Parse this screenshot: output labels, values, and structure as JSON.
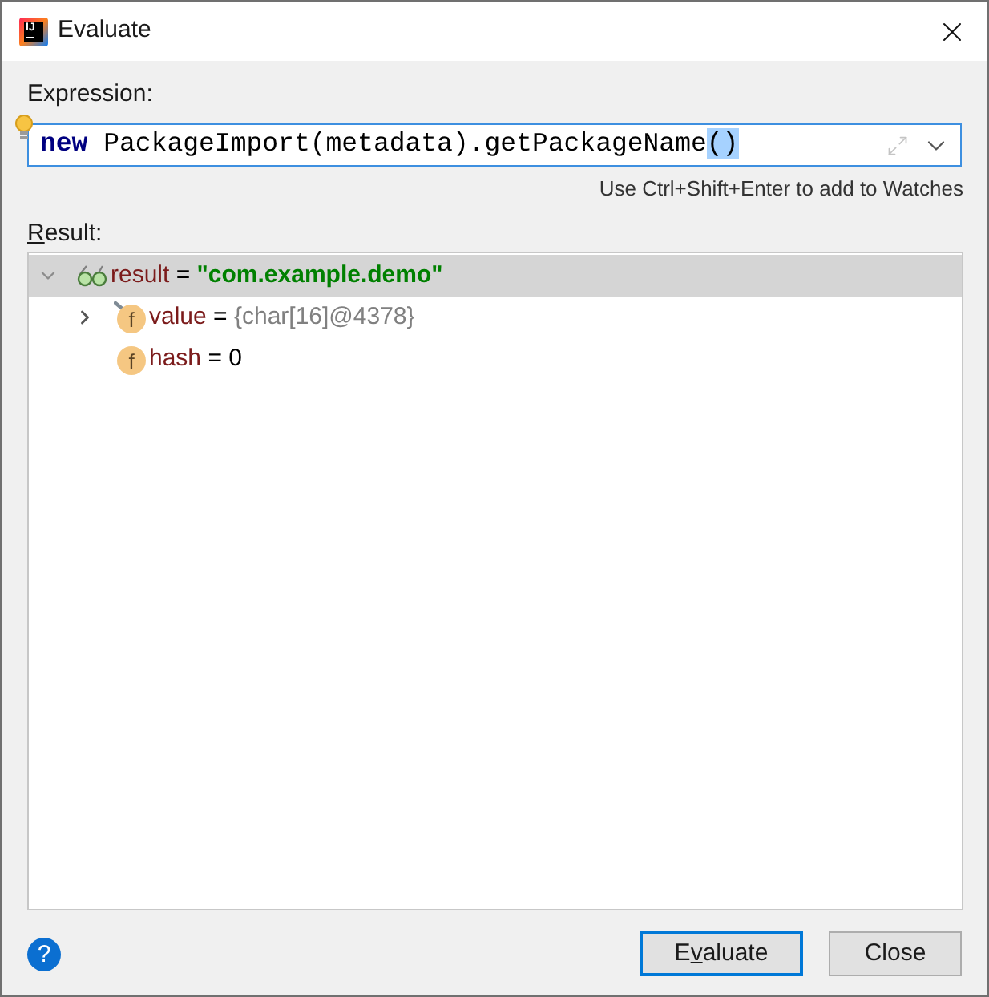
{
  "window": {
    "title": "Evaluate",
    "logo_text": "IJ"
  },
  "expression": {
    "label": "Expression:",
    "tokens": [
      {
        "kind": "keyword",
        "text": "new"
      },
      {
        "kind": "plain",
        "text": " PackageImport(metadata).getPackageName"
      },
      {
        "kind": "highlight",
        "text": "()"
      }
    ],
    "hint": "Use Ctrl+Shift+Enter to add to Watches"
  },
  "result": {
    "label_parts": [
      {
        "text": "R",
        "underline": true
      },
      {
        "text": "esult:",
        "underline": false
      }
    ],
    "tree": [
      {
        "kind": "watch",
        "name": "result",
        "op": "=",
        "value": {
          "kind": "string",
          "text": "\"com.example.demo\""
        },
        "expanded": true,
        "selected": true,
        "children": [
          {
            "kind": "field",
            "badge": "f",
            "final": true,
            "name": "value",
            "op": "=",
            "value": {
              "kind": "reference",
              "text": "{char[16]@4378}"
            },
            "expanded": false,
            "selected": false
          },
          {
            "kind": "field",
            "badge": "f",
            "final": false,
            "name": "hash",
            "op": "=",
            "value": {
              "kind": "primitive",
              "text": "0"
            },
            "selected": false
          }
        ]
      }
    ]
  },
  "footer": {
    "help": "?",
    "buttons": [
      {
        "label_parts": [
          {
            "text": "E",
            "underline": false
          },
          {
            "text": "v",
            "underline": true
          },
          {
            "text": "aluate",
            "underline": false
          }
        ],
        "default": true
      },
      {
        "label_parts": [
          {
            "text": "Close",
            "underline": false
          }
        ],
        "default": false
      }
    ]
  }
}
